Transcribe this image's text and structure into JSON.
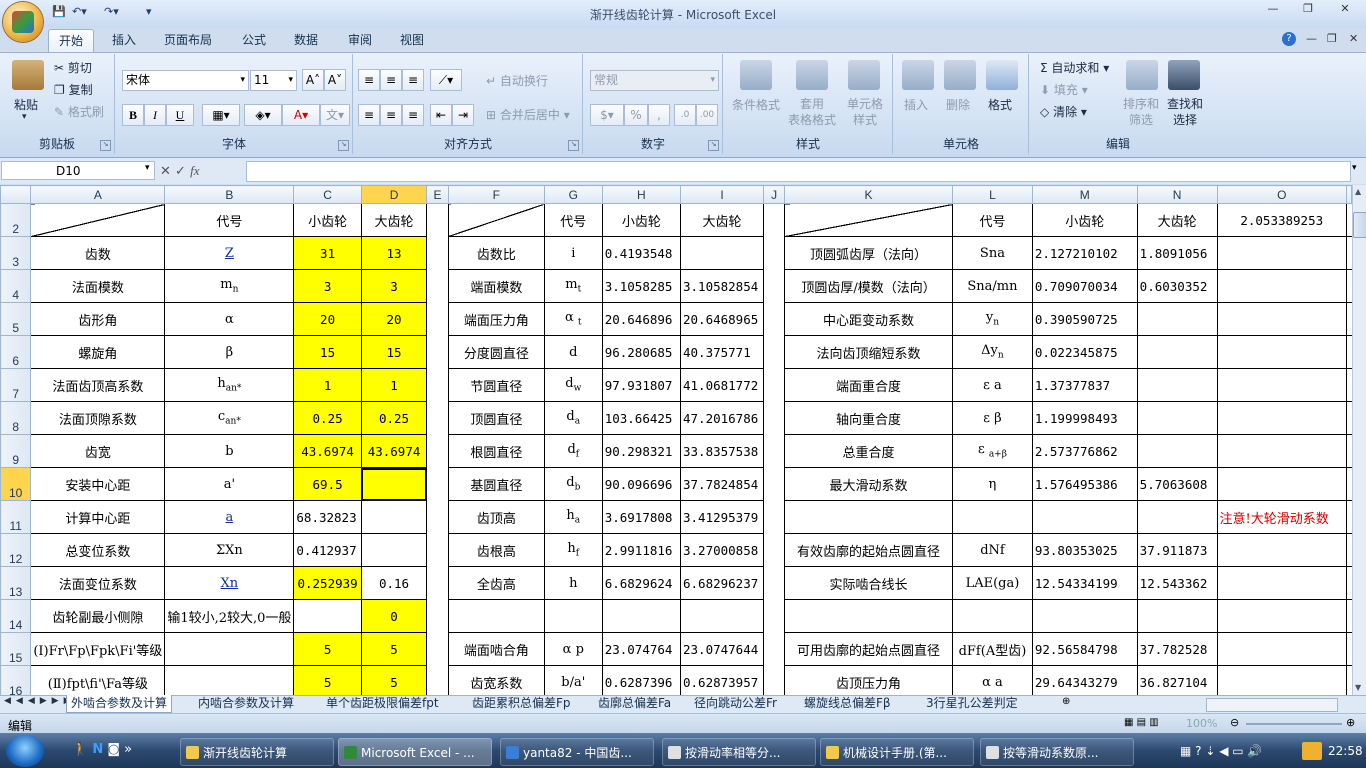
{
  "window": {
    "title": "渐开线齿轮计算 - Microsoft Excel"
  },
  "ribbon_tabs": [
    "开始",
    "插入",
    "页面布局",
    "公式",
    "数据",
    "审阅",
    "视图"
  ],
  "clipboard": {
    "paste": "粘贴",
    "cut": "剪切",
    "copy": "复制",
    "format_painter": "格式刷",
    "label": "剪贴板"
  },
  "font": {
    "name": "宋体",
    "size": "11",
    "label": "字体",
    "bold": "B",
    "italic": "I",
    "underline": "U"
  },
  "alignment": {
    "wrap": "自动换行",
    "merge": "合并后居中",
    "label": "对齐方式"
  },
  "number": {
    "format": "常规",
    "percent": "%",
    "comma": ",",
    "label": "数字"
  },
  "styles": {
    "cond": "条件格式",
    "table": "套用\n表格格式",
    "cell": "单元格\n样式",
    "label": "样式"
  },
  "cells": {
    "insert": "插入",
    "delete": "删除",
    "format": "格式",
    "label": "单元格"
  },
  "editing": {
    "autosum": "自动求和",
    "fill": "填充",
    "clear": "清除",
    "sort": "排序和\n筛选",
    "find": "查找和\n选择",
    "label": "编辑"
  },
  "formula_bar": {
    "name_box": "D10",
    "fx": "fx",
    "value": ""
  },
  "columns": [
    "A",
    "B",
    "C",
    "D",
    "E",
    "F",
    "G",
    "H",
    "I",
    "J",
    "K",
    "L",
    "M",
    "N",
    "O"
  ],
  "rows": [
    {
      "n": "2",
      "cells": [
        "",
        "代号",
        "小齿轮",
        "大齿轮",
        "",
        "",
        "代号",
        "小齿轮",
        "大齿轮",
        "",
        "",
        "代号",
        "小齿轮",
        "大齿轮",
        "2.053389253"
      ]
    },
    {
      "n": "3",
      "cells": [
        "齿数",
        "Z",
        "31",
        "13",
        "",
        "齿数比",
        "i",
        "0.4193548",
        "",
        "",
        "顶圆弧齿厚（法向）",
        "Sna",
        "2.127210102",
        "1.8091056",
        ""
      ]
    },
    {
      "n": "4",
      "cells": [
        "法面模数",
        "mn",
        "3",
        "3",
        "",
        "端面模数",
        "mt",
        "3.1058285",
        "3.10582854",
        "",
        "顶圆齿厚/模数（法向）",
        "Sna/mn",
        "0.709070034",
        "0.6030352",
        ""
      ]
    },
    {
      "n": "5",
      "cells": [
        "齿形角",
        "α",
        "20",
        "20",
        "",
        "端面压力角",
        "α t",
        "20.646896",
        "20.6468965",
        "",
        "中心距变动系数",
        "yn",
        "0.390590725",
        "",
        ""
      ]
    },
    {
      "n": "6",
      "cells": [
        "螺旋角",
        "β",
        "15",
        "15",
        "",
        "分度圆直径",
        "d",
        "96.280685",
        "40.375771",
        "",
        "法向齿顶缩短系数",
        "Δyn",
        "0.022345875",
        "",
        ""
      ]
    },
    {
      "n": "7",
      "cells": [
        "法面齿顶高系数",
        "han*",
        "1",
        "1",
        "",
        "节圆直径",
        "dw",
        "97.931807",
        "41.0681772",
        "",
        "端面重合度",
        "ε a",
        "1.37377837",
        "",
        ""
      ]
    },
    {
      "n": "8",
      "cells": [
        "法面顶隙系数",
        "can*",
        "0.25",
        "0.25",
        "",
        "顶圆直径",
        "da",
        "103.66425",
        "47.2016786",
        "",
        "轴向重合度",
        "ε β",
        "1.199998493",
        "",
        ""
      ]
    },
    {
      "n": "9",
      "cells": [
        "齿宽",
        "b",
        "43.6974",
        "43.6974",
        "",
        "根圆直径",
        "df",
        "90.298321",
        "33.8357538",
        "",
        "总重合度",
        "ε a+β",
        "2.573776862",
        "",
        ""
      ]
    },
    {
      "n": "10",
      "cells": [
        "安装中心距",
        "a'",
        "69.5",
        "",
        "",
        "基圆直径",
        "db",
        "90.096696",
        "37.7824854",
        "",
        "最大滑动系数",
        "η",
        "1.576495386",
        "5.7063608",
        ""
      ]
    },
    {
      "n": "11",
      "cells": [
        "计算中心距",
        "a",
        "68.32823",
        "",
        "",
        "齿顶高",
        "ha",
        "3.6917808",
        "3.41295379",
        "",
        "",
        "",
        "",
        "",
        "注意!大轮滑动系数"
      ]
    },
    {
      "n": "12",
      "cells": [
        "总变位系数",
        "ΣXn",
        "0.412937",
        "",
        "",
        "齿根高",
        "hf",
        "2.9911816",
        "3.27000858",
        "",
        "有效齿廓的起始点圆直径",
        "dNf",
        "93.80353025",
        "37.911873",
        ""
      ]
    },
    {
      "n": "13",
      "cells": [
        "法面变位系数",
        "Xn",
        "0.252939",
        "0.16",
        "",
        "全齿高",
        "h",
        "6.6829624",
        "6.68296237",
        "",
        "实际啮合线长",
        "LAE(ga)",
        "12.54334199",
        "12.543362",
        ""
      ]
    },
    {
      "n": "14",
      "cells": [
        "齿轮副最小侧隙",
        "输1较小,2较大,0一般",
        "",
        "0",
        "",
        "",
        "",
        "",
        "",
        "",
        "",
        "",
        "",
        "",
        ""
      ]
    },
    {
      "n": "15",
      "cells": [
        "(Ⅰ)Fr\\Fp\\Fpk\\Fi'等级",
        "",
        "5",
        "5",
        "",
        "端面啮合角",
        "α p",
        "23.074764",
        "23.0747644",
        "",
        "可用齿廓的起始点圆直径",
        "dFf(A型齿)",
        "92.56584798",
        "37.782528",
        ""
      ]
    },
    {
      "n": "16",
      "cells": [
        "(Ⅱ)fpt\\fi'\\Fa等级",
        "",
        "5",
        "5",
        "",
        "齿宽系数",
        "b/a'",
        "0.6287396",
        "0.62873957",
        "",
        "齿顶压力角",
        "α a",
        "29.64343279",
        "36.827104",
        ""
      ]
    }
  ],
  "sheet_tabs": [
    "外啮合参数及计算",
    "内啮合参数及计算",
    "单个齿距极限偏差fpt",
    "齿距累积总偏差Fp",
    "齿廓总偏差Fa",
    "径向跳动公差Fr",
    "螺旋线总偏差Fβ",
    "3行星孔公差判定"
  ],
  "status": {
    "mode": "编辑",
    "zoom": "100%"
  },
  "taskbar": {
    "items": [
      "渐开线齿轮计算",
      "Microsoft Excel - ...",
      "yanta82 - 中国齿...",
      "按滑动率相等分...",
      "机械设计手册.(第...",
      "按等滑动系数原..."
    ],
    "clock": "22:58"
  },
  "colors": {
    "highlight": "#ffff00",
    "selected_col": "#ffd54f",
    "warning": "#d40000",
    "link": "#1030a0"
  }
}
